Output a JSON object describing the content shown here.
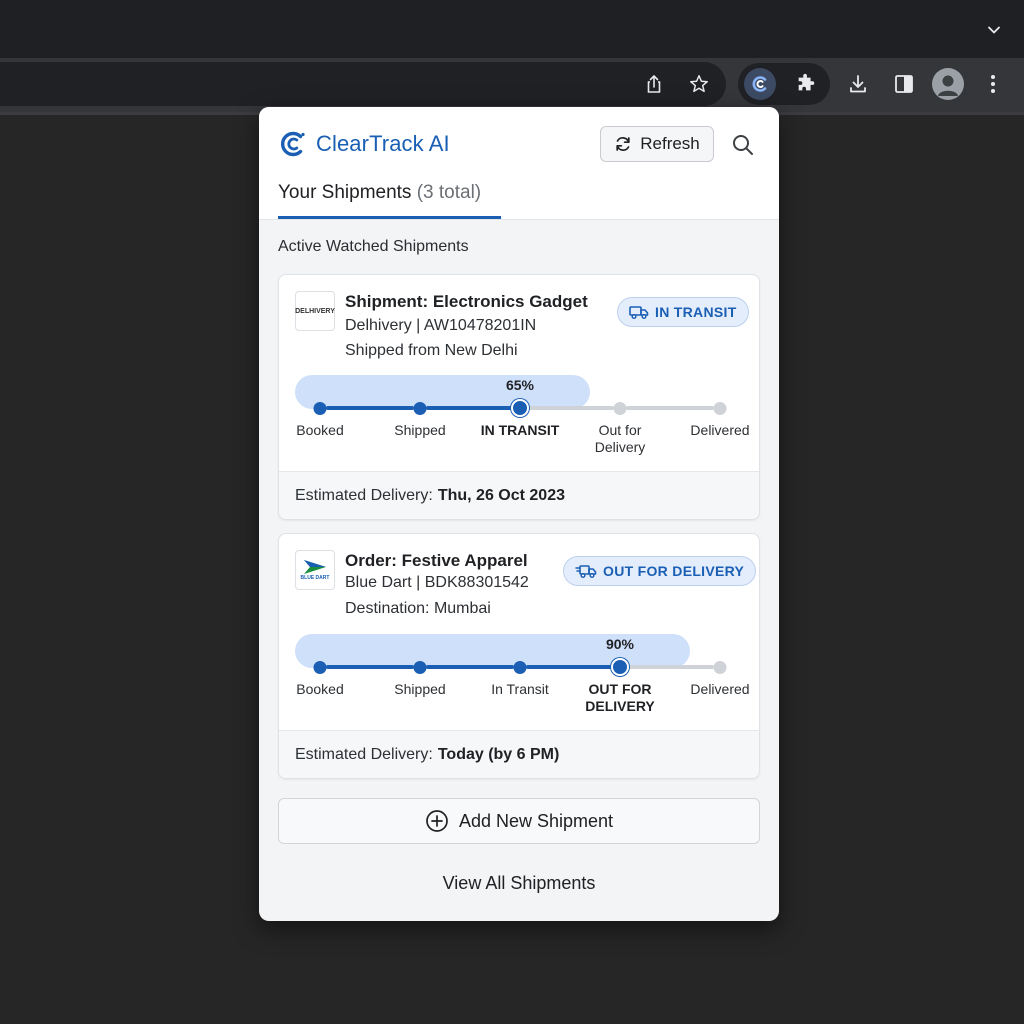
{
  "browser": {
    "toolbar_icons": [
      "share-icon",
      "star-icon",
      "cleartrack-extension-icon",
      "puzzle-extensions-icon",
      "download-icon",
      "side-panel-icon",
      "profile-avatar",
      "more-menu-icon"
    ]
  },
  "popup": {
    "brand_name": "ClearTrack AI",
    "refresh_label": "Refresh",
    "tab_title": "Your Shipments",
    "tab_count": "(3 total)",
    "section_label": "Active Watched Shipments",
    "shipments": [
      {
        "logo_text": "DELHIVERY",
        "title": "Shipment: Electronics Gadget",
        "carrier_line": "Delhivery | AW10478201IN",
        "location_line": "Shipped from New Delhi",
        "status": "IN TRANSIT",
        "progress_label": "65%",
        "progress": 0.65,
        "steps": [
          "Booked",
          "Shipped",
          "IN TRANSIT",
          "Out for Delivery",
          "Delivered"
        ],
        "current_step": 2,
        "eta_label": "Estimated Delivery:",
        "eta_value": "Thu, 26 Oct 2023"
      },
      {
        "logo_text": "BLUE DART",
        "title": "Order: Festive Apparel",
        "carrier_line": "Blue Dart | BDK88301542",
        "location_line": "Destination: Mumbai",
        "status": "OUT FOR DELIVERY",
        "progress_label": "90%",
        "progress": 0.9,
        "steps": [
          "Booked",
          "Shipped",
          "In Transit",
          "OUT FOR DELIVERY",
          "Delivered"
        ],
        "current_step": 3,
        "eta_label": "Estimated Delivery:",
        "eta_value": "Today (by 6 PM)"
      }
    ],
    "add_button_label": "Add New Shipment",
    "view_all_label": "View All Shipments"
  },
  "colors": {
    "accent": "#1a5fb4",
    "track_fill": "#cfe0fa",
    "inactive": "#cfd3d8"
  }
}
